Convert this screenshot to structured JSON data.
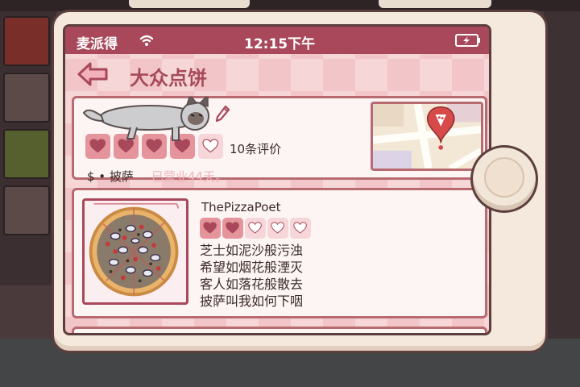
{
  "status_bar": {
    "carrier": "麦派得",
    "time": "12:15下午"
  },
  "nav": {
    "title": "大众点饼"
  },
  "shop": {
    "rating": 4,
    "max_rating": 5,
    "review_count": "10条评价",
    "price_category": "$ • 披萨",
    "open_days": "已营业44天。"
  },
  "review": {
    "author": "ThePizzaPoet",
    "rating": 2,
    "max_rating": 5,
    "lines": [
      "芝士如泥沙般污浊",
      "希望如烟花般湮灭",
      "客人如落花般散去",
      "披萨叫我如何下咽"
    ]
  },
  "colors": {
    "accent": "#a8485a",
    "heart_filled": "#e5949c",
    "heart_empty": "#f6d6d8",
    "map_pin": "#d64a4a"
  },
  "icons": {
    "back": "left-arrow-icon",
    "wifi": "wifi-icon",
    "battery": "battery-charging-icon",
    "pin": "pizza-map-pin-icon",
    "edit": "pencil-icon"
  }
}
